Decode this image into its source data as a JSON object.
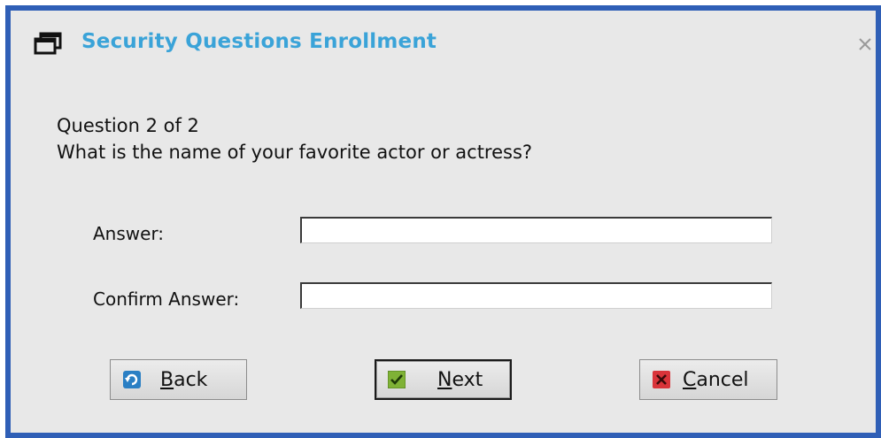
{
  "window": {
    "title": "Security Questions Enrollment",
    "icon": "window-icon",
    "close_glyph": "close-icon",
    "border_color": "#2f5fb6",
    "title_color": "#3aa3d8"
  },
  "question": {
    "counter": "Question 2 of 2",
    "text": "What is the name of your favorite actor or actress?"
  },
  "form": {
    "answer_label": "Answer:",
    "answer_value": "",
    "confirm_label": "Confirm Answer:",
    "confirm_value": ""
  },
  "buttons": {
    "back": {
      "mnemonic": "B",
      "rest": "ack",
      "icon": "back-refresh-icon",
      "icon_color": "#2a7fc4"
    },
    "next": {
      "mnemonic": "N",
      "rest": "ext",
      "icon": "checkmark-icon",
      "icon_color": "#7fb236",
      "default": true
    },
    "cancel": {
      "mnemonic": "C",
      "rest": "ancel",
      "icon": "cancel-x-icon",
      "icon_color": "#d9343a"
    }
  }
}
